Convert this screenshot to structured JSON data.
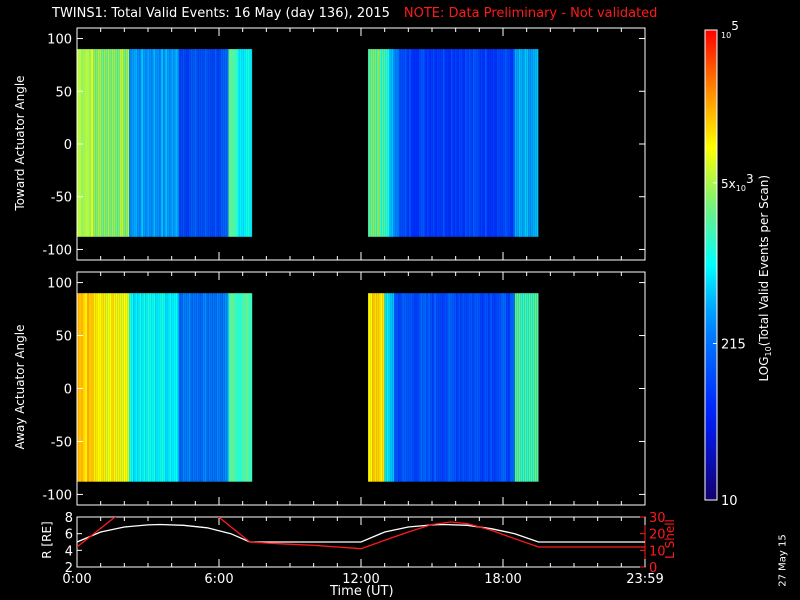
{
  "chart_data": [
    {
      "type": "heatmap",
      "title": "TWINS1: Total Valid Events: 16 May (day 136), 2015",
      "note": "NOTE: Data Preliminary - Not validated",
      "panels": [
        {
          "name": "toward",
          "ylabel": "Toward Actuator Angle",
          "ylim": [
            -110,
            110
          ],
          "yticks": [
            "100",
            "50",
            "0",
            "-50",
            "-100"
          ],
          "data_angle_range": [
            -88,
            90
          ],
          "segments_hours_log": [
            [
              0.0,
              0.7,
              3.75
            ],
            [
              0.7,
              2.2,
              3.6
            ],
            [
              2.2,
              4.3,
              2.6
            ],
            [
              4.3,
              6.4,
              2.1
            ],
            [
              6.4,
              6.8,
              3.3
            ],
            [
              6.8,
              7.4,
              3.0
            ],
            [
              12.3,
              12.8,
              3.5
            ],
            [
              12.8,
              13.2,
              3.2
            ],
            [
              13.2,
              13.6,
              2.6
            ],
            [
              13.6,
              18.5,
              2.0
            ],
            [
              18.5,
              18.9,
              2.6
            ],
            [
              18.9,
              19.5,
              2.6
            ]
          ]
        },
        {
          "name": "away",
          "ylabel": "Away Actuator Angle",
          "ylim": [
            -110,
            110
          ],
          "yticks": [
            "100",
            "50",
            "0",
            "-50",
            "-100"
          ],
          "data_angle_range": [
            -88,
            90
          ],
          "segments_hours_log": [
            [
              0.0,
              0.7,
              4.2
            ],
            [
              0.7,
              2.2,
              4.0
            ],
            [
              2.2,
              4.3,
              3.0
            ],
            [
              4.3,
              6.4,
              2.4
            ],
            [
              6.4,
              7.4,
              3.3
            ],
            [
              12.3,
              13.0,
              4.1
            ],
            [
              13.0,
              13.4,
              2.8
            ],
            [
              13.4,
              18.5,
              2.1
            ],
            [
              18.5,
              19.5,
              3.3
            ]
          ]
        }
      ],
      "colorbar": {
        "label": "LOG10(Total Valid Events per Scan)",
        "label_main": "LOG",
        "label_sub": "10",
        "label_rest": "(Total Valid Events per Scan)",
        "range_log": [
          1,
          5
        ],
        "ticks": [
          {
            "log": 5,
            "base": "10",
            "exp": "5",
            "prefix": ""
          },
          {
            "log": 3.699,
            "base": "10",
            "exp": "3",
            "prefix": "5x"
          },
          {
            "log": 2.332,
            "text": "215"
          },
          {
            "log": 1,
            "text": "10"
          }
        ]
      },
      "ephemeris": {
        "type": "line",
        "xlabel": "Time (UT)",
        "xticks": [
          "0:00",
          "6:00",
          "12:00",
          "18:00",
          "23:59"
        ],
        "xlim_hours": [
          0,
          24
        ],
        "ylabel_left": "R [RE]",
        "ylabel_left_main": "R [R",
        "ylabel_left_sub": "E",
        "ylabel_left_end": "]",
        "ylim_left": [
          2,
          8
        ],
        "yticks_left": [
          "8",
          "6",
          "4",
          "2"
        ],
        "ylabel_right": "L Shell",
        "ylim_right": [
          0,
          30
        ],
        "yticks_right": [
          "30",
          "20",
          "10",
          "0"
        ],
        "series": [
          {
            "name": "R",
            "color": "#ffffff",
            "x": [
              0,
              1,
              2,
              3,
              3.5,
              4.5,
              5.5,
              6.5,
              7.3,
              12.0,
              13,
              14,
              15,
              15.5,
              16.5,
              17.5,
              18.5,
              19.5,
              24
            ],
            "y": [
              5.0,
              6.2,
              6.8,
              7.05,
              7.1,
              7.0,
              6.7,
              6.0,
              5.0,
              5.0,
              6.2,
              6.8,
              7.05,
              7.1,
              7.0,
              6.6,
              6.0,
              5.0,
              5.0
            ]
          },
          {
            "name": "L Shell",
            "color": "#ff1a1a",
            "x": [
              0,
              1.7,
              null,
              5.9,
              7.3,
              8.5,
              10,
              11,
              12.0,
              13,
              14,
              15,
              15.8,
              16.5,
              17.5,
              18.5,
              19.5,
              24
            ],
            "y": [
              12,
              31,
              null,
              31,
              15,
              14,
              13,
              12,
              11,
              16,
              21,
              25.5,
              27,
              26,
              22,
              17,
              12,
              12
            ]
          }
        ]
      },
      "date_stamp": "27 May 15"
    }
  ]
}
